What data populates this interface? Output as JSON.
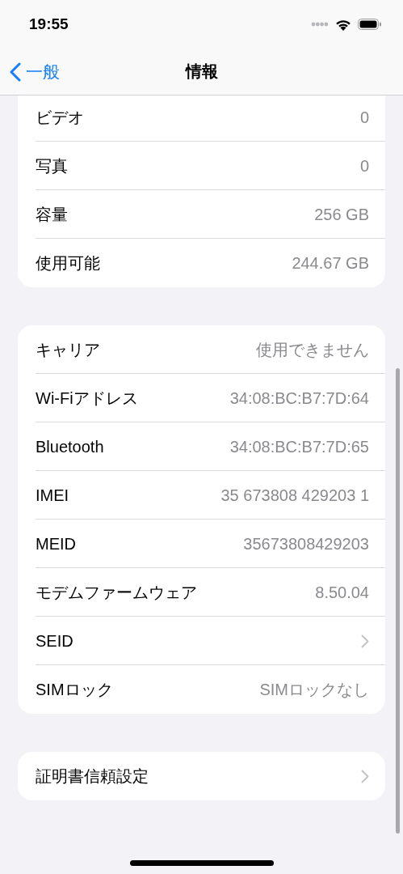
{
  "status_bar": {
    "time": "19:55"
  },
  "nav": {
    "back": "一般",
    "title": "情報"
  },
  "groups": [
    {
      "rows": [
        {
          "kind": "value",
          "label": "ビデオ",
          "value": "0"
        },
        {
          "kind": "value",
          "label": "写真",
          "value": "0"
        },
        {
          "kind": "value",
          "label": "容量",
          "value": "256 GB"
        },
        {
          "kind": "value",
          "label": "使用可能",
          "value": "244.67 GB"
        }
      ]
    },
    {
      "rows": [
        {
          "kind": "value",
          "label": "キャリア",
          "value": "使用できません"
        },
        {
          "kind": "value",
          "label": "Wi-Fiアドレス",
          "value": "34:08:BC:B7:7D:64"
        },
        {
          "kind": "value",
          "label": "Bluetooth",
          "value": "34:08:BC:B7:7D:65"
        },
        {
          "kind": "value",
          "label": "IMEI",
          "value": "35 673808 429203 1"
        },
        {
          "kind": "value",
          "label": "MEID",
          "value": "35673808429203"
        },
        {
          "kind": "value",
          "label": "モデムファームウェア",
          "value": "8.50.04"
        },
        {
          "kind": "link",
          "label": "SEID"
        },
        {
          "kind": "value",
          "label": "SIMロック",
          "value": "SIMロックなし"
        }
      ]
    },
    {
      "rows": [
        {
          "kind": "link",
          "label": "証明書信頼設定"
        }
      ]
    }
  ]
}
